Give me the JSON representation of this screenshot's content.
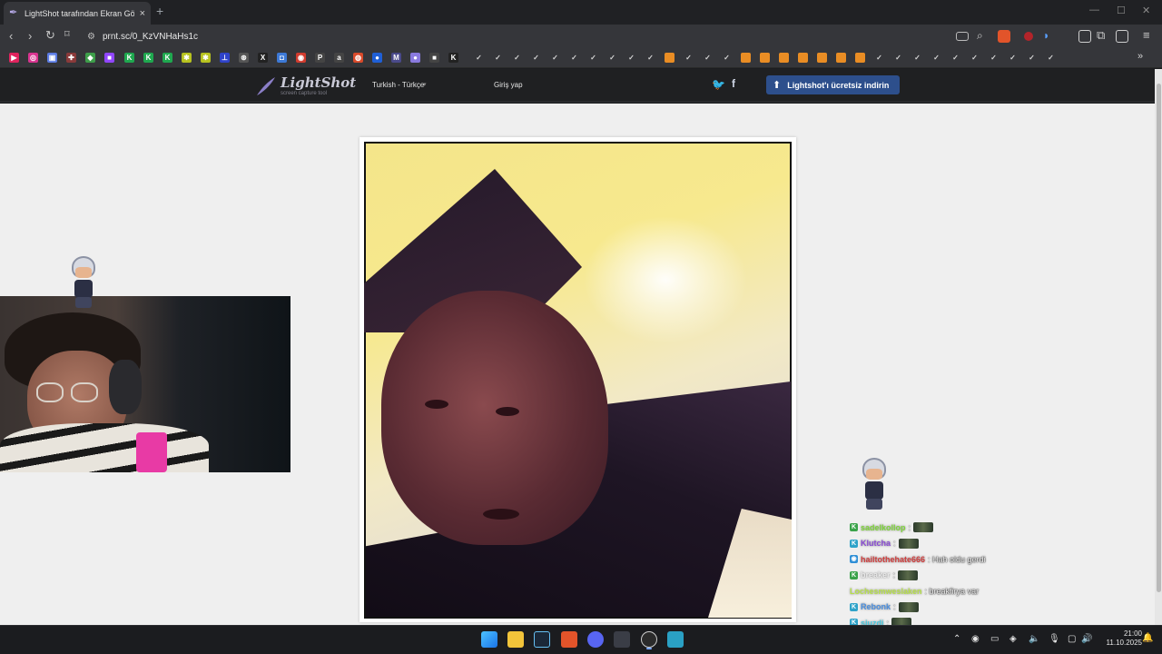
{
  "browser": {
    "tab_title": "LightShot tarafından Ekran Görü...",
    "new_tab": "+",
    "url": "prnt.sc/0_KzVNHaHs1c",
    "win_min": "—",
    "win_max": "☐",
    "win_close": "✕"
  },
  "bookmarks": [
    {
      "glyph": "▶",
      "color": "#e0245e"
    },
    {
      "glyph": "◎",
      "color": "#d8338f"
    },
    {
      "glyph": "▣",
      "color": "#5b7be3"
    },
    {
      "glyph": "✚",
      "color": "#8a3a3a"
    },
    {
      "glyph": "◆",
      "color": "#3e9e4a"
    },
    {
      "glyph": "■",
      "color": "#9146ff"
    },
    {
      "glyph": "K",
      "color": "#1fa84f"
    },
    {
      "glyph": "K",
      "color": "#1fa84f"
    },
    {
      "glyph": "K",
      "color": "#1fa84f"
    },
    {
      "glyph": "✱",
      "color": "#b7c21f"
    },
    {
      "glyph": "✱",
      "color": "#b7c21f"
    },
    {
      "glyph": "⊥",
      "color": "#2f43c9"
    },
    {
      "glyph": "⊛",
      "color": "#555555"
    },
    {
      "glyph": "X",
      "color": "#222222"
    },
    {
      "glyph": "◘",
      "color": "#3d79d6"
    },
    {
      "glyph": "◉",
      "color": "#d13b2e"
    },
    {
      "glyph": "P",
      "color": "#444444"
    },
    {
      "glyph": "a",
      "color": "#444444"
    },
    {
      "glyph": "◍",
      "color": "#d94a2b"
    },
    {
      "glyph": "●",
      "color": "#1f5fd6"
    },
    {
      "glyph": "M",
      "color": "#4a4a8a"
    },
    {
      "glyph": "●",
      "color": "#8a7adf"
    },
    {
      "glyph": "■",
      "color": "#444444"
    },
    {
      "glyph": "K",
      "color": "#222222"
    }
  ],
  "lightshot": {
    "logo_name": "LightShot",
    "logo_sub": "screen capture tool",
    "language": "Turkish - Türkçe",
    "login": "Giriş yap",
    "twitter": "🐦",
    "facebook": "f",
    "download": "Lightshot'ı ücretsiz indirin",
    "colors": {
      "header": "#1f2022",
      "button": "#2d4f8c",
      "page": "#efefef"
    }
  },
  "chat": [
    {
      "badge": "K",
      "badge_color": "#3aa34a",
      "user": "sadelkollop",
      "user_color": "#7fd63a",
      "msg": ":",
      "emote": true
    },
    {
      "badge": "K",
      "badge_color": "#2fa3c9",
      "user": "Klutcha",
      "user_color": "#8a4bd6",
      "msg": ":",
      "emote": true
    },
    {
      "badge": "◉",
      "badge_color": "#2f8fd6",
      "user": "hailtothehate666",
      "user_color": "#d23d3d",
      "msg": ": Hah oldu gerdi",
      "emote": false
    },
    {
      "badge": "K",
      "badge_color": "#3aa34a",
      "user": "breaker",
      "user_color": "#e8e8e8",
      "msg": ":",
      "emote": true
    },
    {
      "badge": "",
      "badge_color": "",
      "user": "Lochesmweslaken",
      "user_color": "#b7e04a",
      "msg": ": breakfirya var",
      "emote": false
    },
    {
      "badge": "K",
      "badge_color": "#2fa3c9",
      "user": "Rebonk",
      "user_color": "#4a8fe0",
      "msg": ":",
      "emote": true
    },
    {
      "badge": "K",
      "badge_color": "#2fa3c9",
      "user": "sjuzdi",
      "user_color": "#4ac9e0",
      "msg": ":",
      "emote": true
    }
  ],
  "taskbar": {
    "clock_time": "21:00",
    "clock_date": "11.10.2025"
  }
}
